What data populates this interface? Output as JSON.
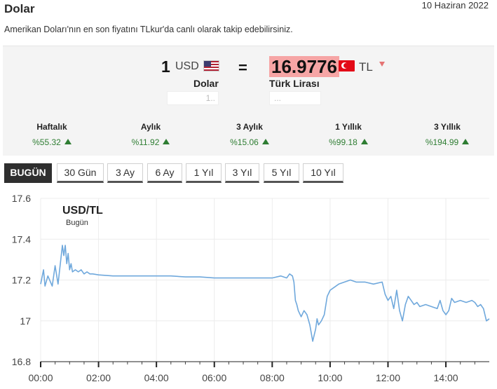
{
  "header": {
    "title": "Dolar",
    "date": "10 Haziran 2022",
    "description": "Amerikan Doları'nın en son fiyatını TLkur'da canlı olarak takip edebilirsiniz."
  },
  "converter": {
    "amount": "1",
    "from_code": "USD",
    "from_label": "Dolar",
    "equals": "=",
    "rate": "16.9776",
    "to_code": "TL",
    "to_label": "Türk Lirası",
    "from_input": "1..",
    "to_input": "...",
    "trend": "down",
    "colors": {
      "rate_highlight": "#f6a5a5",
      "trend_down": "#e57373",
      "trend_up": "#2e7d32"
    }
  },
  "changes": [
    {
      "label": "Haftalık",
      "value": "%55.32"
    },
    {
      "label": "Aylık",
      "value": "%11.92"
    },
    {
      "label": "3 Aylık",
      "value": "%15.06"
    },
    {
      "label": "1 Yıllık",
      "value": "%99.18"
    },
    {
      "label": "3 Yıllık",
      "value": "%194.99"
    }
  ],
  "tabs": [
    {
      "label": "BUGÜN",
      "active": true
    },
    {
      "label": "30 Gün"
    },
    {
      "label": "3 Ay"
    },
    {
      "label": "6 Ay"
    },
    {
      "label": "1 Yıl"
    },
    {
      "label": "3 Yıl"
    },
    {
      "label": "5 Yıl"
    },
    {
      "label": "10 Yıl"
    }
  ],
  "chart_data": {
    "type": "line",
    "title": "USD/TL",
    "subtitle": "Bugün",
    "line_color": "#6fa8dc",
    "ylim": [
      16.8,
      17.6
    ],
    "yticks": [
      "17.6",
      "17.4",
      "17.2",
      "17",
      "16.8"
    ],
    "xlim": [
      0,
      15.5
    ],
    "xticks": [
      "00:00",
      "02:00",
      "04:00",
      "06:00",
      "08:00",
      "10:00",
      "12:00",
      "14:00"
    ],
    "grid": true,
    "series": [
      {
        "x": [
          0.0,
          0.1,
          0.15,
          0.25,
          0.4,
          0.5,
          0.6,
          0.75,
          0.8,
          0.85,
          0.9,
          0.95,
          1.0,
          1.05,
          1.1,
          1.2,
          1.3,
          1.4,
          1.5,
          1.6,
          1.7,
          1.8,
          2.0,
          2.5,
          3.0,
          3.5,
          4.0,
          4.5,
          5.0,
          5.5,
          6.0,
          6.5,
          7.0,
          7.5,
          8.0,
          8.3,
          8.5,
          8.6,
          8.7,
          8.75,
          8.8,
          8.85,
          8.9,
          9.0,
          9.1,
          9.2,
          9.3,
          9.4,
          9.45,
          9.5,
          9.55,
          9.6,
          9.7,
          9.8,
          9.9,
          10.0,
          10.1,
          10.3,
          10.5,
          10.7,
          10.9,
          11.2,
          11.5,
          11.8,
          11.9,
          12.0,
          12.1,
          12.2,
          12.3,
          12.4,
          12.5,
          12.6,
          12.7,
          12.8,
          12.9,
          13.0,
          13.1,
          13.3,
          13.5,
          13.7,
          13.8,
          13.9,
          14.0,
          14.1,
          14.2,
          14.3,
          14.5,
          14.7,
          14.9,
          15.0,
          15.1,
          15.2,
          15.3,
          15.4,
          15.5
        ],
        "y": [
          17.18,
          17.25,
          17.17,
          17.22,
          17.17,
          17.27,
          17.18,
          17.37,
          17.32,
          17.37,
          17.28,
          17.33,
          17.25,
          17.28,
          17.24,
          17.25,
          17.24,
          17.25,
          17.23,
          17.24,
          17.23,
          17.23,
          17.225,
          17.22,
          17.22,
          17.22,
          17.22,
          17.22,
          17.215,
          17.215,
          17.21,
          17.21,
          17.21,
          17.21,
          17.21,
          17.22,
          17.21,
          17.23,
          17.22,
          17.19,
          17.1,
          17.08,
          17.05,
          17.02,
          17.05,
          17.03,
          16.98,
          16.9,
          16.93,
          16.96,
          17.01,
          16.98,
          17.0,
          17.03,
          17.12,
          17.15,
          17.16,
          17.18,
          17.19,
          17.2,
          17.19,
          17.19,
          17.18,
          17.19,
          17.13,
          17.1,
          17.12,
          17.06,
          17.15,
          17.05,
          17.0,
          17.08,
          17.12,
          17.1,
          17.08,
          17.09,
          17.07,
          17.08,
          17.07,
          17.06,
          17.1,
          17.05,
          17.03,
          17.05,
          17.11,
          17.09,
          17.1,
          17.09,
          17.1,
          17.09,
          17.07,
          17.08,
          17.06,
          17.0,
          17.01
        ]
      }
    ]
  }
}
